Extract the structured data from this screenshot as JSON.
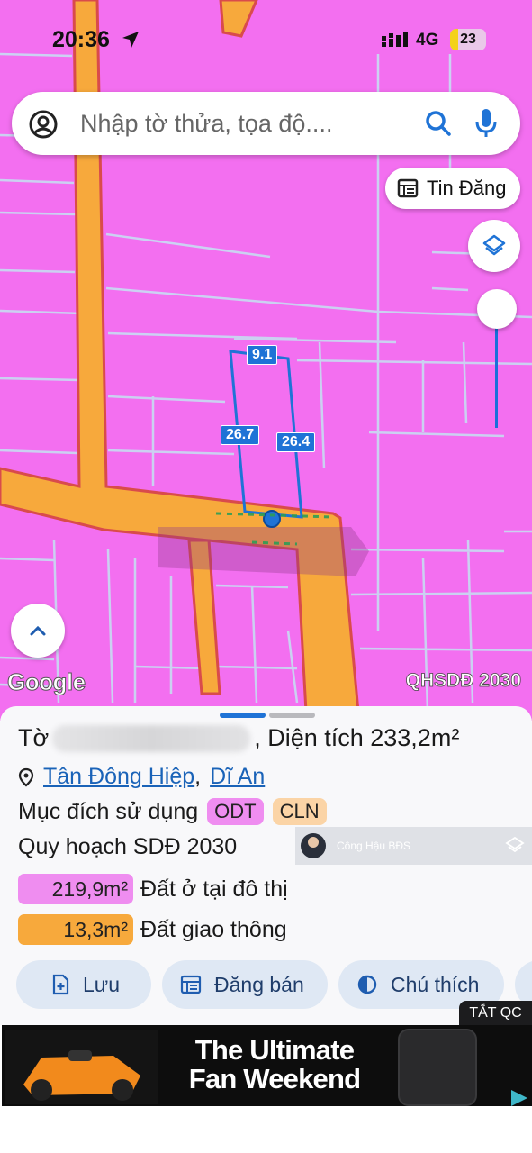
{
  "status": {
    "time": "20:36",
    "network": "4G",
    "battery": "23",
    "battery_level": 0.23
  },
  "search": {
    "placeholder": "Nhập tờ thửa, tọa độ...."
  },
  "map_controls": {
    "listing_label": "Tin Đăng"
  },
  "map": {
    "dimensions": {
      "top": "9.1",
      "left": "26.7",
      "right": "26.4"
    },
    "provider_logo": "Google",
    "layer_label": "QHSDĐ 2030"
  },
  "chat_overlay": {
    "name": "Công Hậu BĐS"
  },
  "panel": {
    "title_prefix": "Tờ",
    "title_suffix": ", Diện tích 233,2m²",
    "ward": "Tân Đông Hiệp",
    "separator": ",",
    "city": "Dĩ An",
    "purpose_label": "Mục đích sử dụng",
    "purpose_codes": [
      "ODT",
      "CLN"
    ],
    "plan_label": "Quy hoạch SDĐ 2030",
    "areas": [
      {
        "value": "219,9m²",
        "label": "Đất ở tại đô thị",
        "color": "#ef8df0"
      },
      {
        "value": "13,3m²",
        "label": "Đất giao thông",
        "color": "#f7a93c"
      }
    ],
    "actions": [
      {
        "label": "Lưu",
        "icon": "save-icon"
      },
      {
        "label": "Đăng bán",
        "icon": "listing-icon"
      },
      {
        "label": "Chú thích",
        "icon": "legend-icon"
      }
    ]
  },
  "ad": {
    "close_label": "TẮT QC",
    "headline_line1": "The Ultimate",
    "headline_line2": "Fan Weekend"
  },
  "colors": {
    "map_pink": "#f36ff0",
    "road_orange": "#f7a93c",
    "accent_blue": "#1f73d6",
    "link_blue": "#1a63b8"
  }
}
